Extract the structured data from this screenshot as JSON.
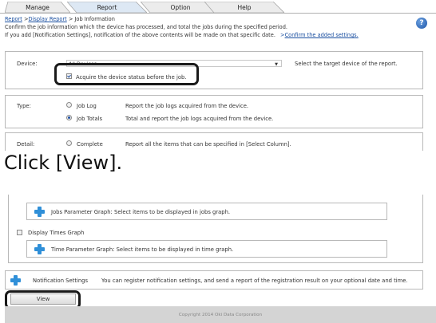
{
  "tabs": [
    "Manage",
    "Report",
    "Option",
    "Help"
  ],
  "breadcrumb": {
    "part1": "Report",
    "sep1": " >",
    "part2": "Display Report",
    "sep2": " > ",
    "current": "Job Information"
  },
  "description": {
    "line1": "Confirm the job information which the device has processed, and total the jobs during the specified period.",
    "line2_prefix": "If you add [Notification Settings], notification of the above contents will be made on that specific date.",
    "line2_arrow": ">",
    "line2_link": "Confirm the added settings."
  },
  "help_icon": "?",
  "device": {
    "label": "Device:",
    "value": "All Devices",
    "hint": "Select the target device of the report.",
    "acquire_label": "Acquire the device status before the job."
  },
  "type": {
    "label": "Type:",
    "options": [
      {
        "label": "Job Log",
        "desc": "Report the job logs acquired from the device.",
        "checked": false
      },
      {
        "label": "Job Totals",
        "desc": "Total and report the job logs acquired from the device.",
        "checked": true
      }
    ]
  },
  "detail": {
    "label": "Detail:",
    "option_label": "Complete",
    "option_desc": "Report all the items that can be specified in [Select Column]."
  },
  "instruction": "Click [View].",
  "jobs_param": "Jobs Parameter Graph: Select items to be displayed in jobs graph.",
  "display_times": "Display Times Graph",
  "time_param": "Time Parameter Graph: Select items to be displayed in time graph.",
  "notification": {
    "label": "Notification Settings",
    "desc": "You can register notification settings, and send a report of the registration result on your optional date and time."
  },
  "view_button": "View",
  "copyright": "Copyright 2014 Oki Data Corporation",
  "colors": {
    "accent_blue": "#2f8fd8",
    "tab_active": "#dde8f4",
    "link": "#1a4fa0"
  },
  "icons": {
    "help": "question-icon",
    "add": "plus-icon",
    "select_caret": "chevron-down-icon"
  }
}
